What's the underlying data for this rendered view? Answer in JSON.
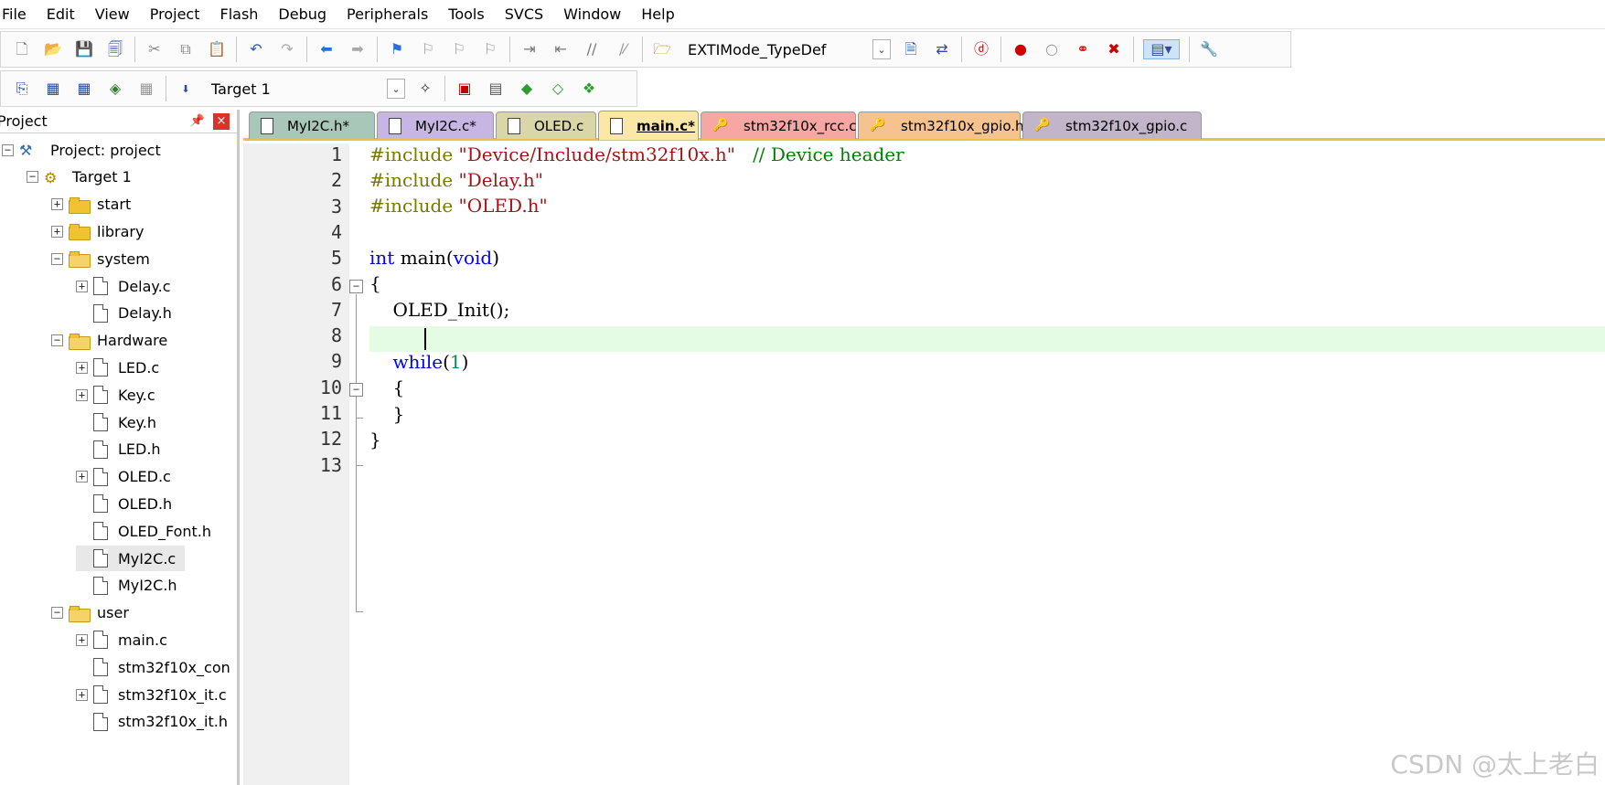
{
  "menu": [
    "File",
    "Edit",
    "View",
    "Project",
    "Flash",
    "Debug",
    "Peripherals",
    "Tools",
    "SVCS",
    "Window",
    "Help"
  ],
  "toolbar1": {
    "icons": [
      "new-file-icon",
      "open-file-icon",
      "save-icon",
      "save-all-icon",
      "cut-icon",
      "copy-icon",
      "paste-icon",
      "undo-icon",
      "redo-icon",
      "nav-back-icon",
      "nav-forward-icon",
      "bookmark-set-icon",
      "bookmark-prev-icon",
      "bookmark-next-icon",
      "bookmark-clear-icon",
      "indent-icon",
      "unindent-icon",
      "comment-icon",
      "uncomment-icon",
      "find-in-files-icon"
    ],
    "find_value": "EXTIMode_TypeDef",
    "icons_after": [
      "incremental-find-icon",
      "browse-icon",
      "debug-session-icon",
      "breakpoint-insert-icon",
      "breakpoint-disable-icon",
      "breakpoint-disable-all-icon",
      "breakpoint-kill-all-icon",
      "window-layout-icon",
      "configure-icon"
    ]
  },
  "toolbar2": {
    "icons": [
      "translate-icon",
      "build-icon",
      "rebuild-icon",
      "batch-build-icon",
      "stop-build-icon",
      "download-icon"
    ],
    "target_value": "Target 1",
    "icons_after": [
      "target-options-icon",
      "file-extensions-icon",
      "manage-project-icon",
      "select-packs-icon",
      "pack-installer-icon",
      "manage-rte-icon"
    ]
  },
  "project_panel": {
    "title": "Project",
    "pin": "ᵖ",
    "close": "×",
    "tree": [
      {
        "label": "Project: project",
        "depth": 0,
        "type": "project",
        "exp": "-"
      },
      {
        "label": "Target 1",
        "depth": 1,
        "type": "target",
        "exp": "-"
      },
      {
        "label": "start",
        "depth": 2,
        "type": "folder",
        "exp": "+"
      },
      {
        "label": "library",
        "depth": 2,
        "type": "folder",
        "exp": "+"
      },
      {
        "label": "system",
        "depth": 2,
        "type": "folder-open",
        "exp": "-"
      },
      {
        "label": "Delay.c",
        "depth": 3,
        "type": "file",
        "exp": "+"
      },
      {
        "label": "Delay.h",
        "depth": 3,
        "type": "file",
        "exp": ""
      },
      {
        "label": "Hardware",
        "depth": 2,
        "type": "folder-open",
        "exp": "-"
      },
      {
        "label": "LED.c",
        "depth": 3,
        "type": "file",
        "exp": "+"
      },
      {
        "label": "Key.c",
        "depth": 3,
        "type": "file",
        "exp": "+"
      },
      {
        "label": "Key.h",
        "depth": 3,
        "type": "file",
        "exp": ""
      },
      {
        "label": "LED.h",
        "depth": 3,
        "type": "file",
        "exp": ""
      },
      {
        "label": "OLED.c",
        "depth": 3,
        "type": "file",
        "exp": "+"
      },
      {
        "label": "OLED.h",
        "depth": 3,
        "type": "file",
        "exp": ""
      },
      {
        "label": "OLED_Font.h",
        "depth": 3,
        "type": "file",
        "exp": ""
      },
      {
        "label": "MyI2C.c",
        "depth": 3,
        "type": "file",
        "exp": "",
        "selected": true
      },
      {
        "label": "MyI2C.h",
        "depth": 3,
        "type": "file",
        "exp": ""
      },
      {
        "label": "user",
        "depth": 2,
        "type": "folder-open",
        "exp": "-"
      },
      {
        "label": "main.c",
        "depth": 3,
        "type": "file",
        "exp": "+"
      },
      {
        "label": "stm32f10x_con",
        "depth": 3,
        "type": "file",
        "exp": ""
      },
      {
        "label": "stm32f10x_it.c",
        "depth": 3,
        "type": "file",
        "exp": "+"
      },
      {
        "label": "stm32f10x_it.h",
        "depth": 3,
        "type": "file",
        "exp": ""
      }
    ]
  },
  "tabs": [
    {
      "label": "MyI2C.h*",
      "color": "#a8c7b8",
      "icon": "file",
      "active": false
    },
    {
      "label": "MyI2C.c*",
      "color": "#c7b5e3",
      "icon": "file",
      "active": false
    },
    {
      "label": "OLED.c",
      "color": "#d9d6a8",
      "icon": "file",
      "active": false
    },
    {
      "label": "main.c*",
      "color": "#fbe8a6",
      "icon": "file",
      "active": true
    },
    {
      "label": "stm32f10x_rcc.c",
      "color": "#f6a7a3",
      "icon": "key",
      "active": false
    },
    {
      "label": "stm32f10x_gpio.h",
      "color": "#f6c38f",
      "icon": "key",
      "active": false
    },
    {
      "label": "stm32f10x_gpio.c",
      "color": "#c2b4c9",
      "icon": "key",
      "active": false
    }
  ],
  "editor": {
    "lines": [
      "1",
      "2",
      "3",
      "4",
      "5",
      "6",
      "7",
      "8",
      "9",
      "10",
      "11",
      "12",
      "13"
    ],
    "code": {
      "l1_pp": "#include",
      "l1_str": "\"Device/Include/stm32f10x.h\"",
      "l1_cm": "// Device header",
      "l2_pp": "#include",
      "l2_str": "\"Delay.h\"",
      "l3_pp": "#include",
      "l3_str": "\"OLED.h\"",
      "l5_kw1": "int",
      "l5_mid": "main(",
      "l5_kw2": "void",
      "l5_end": ")",
      "l6": "{",
      "l7": "OLED_Init();",
      "l9_kw": "while",
      "l9_a": "(",
      "l9_num": "1",
      "l9_b": ")",
      "l10": "{",
      "l11": "}",
      "l12": "}"
    },
    "current_line": 8,
    "current_line_color": "#e4fbe4"
  },
  "watermark": "CSDN @太上老白"
}
